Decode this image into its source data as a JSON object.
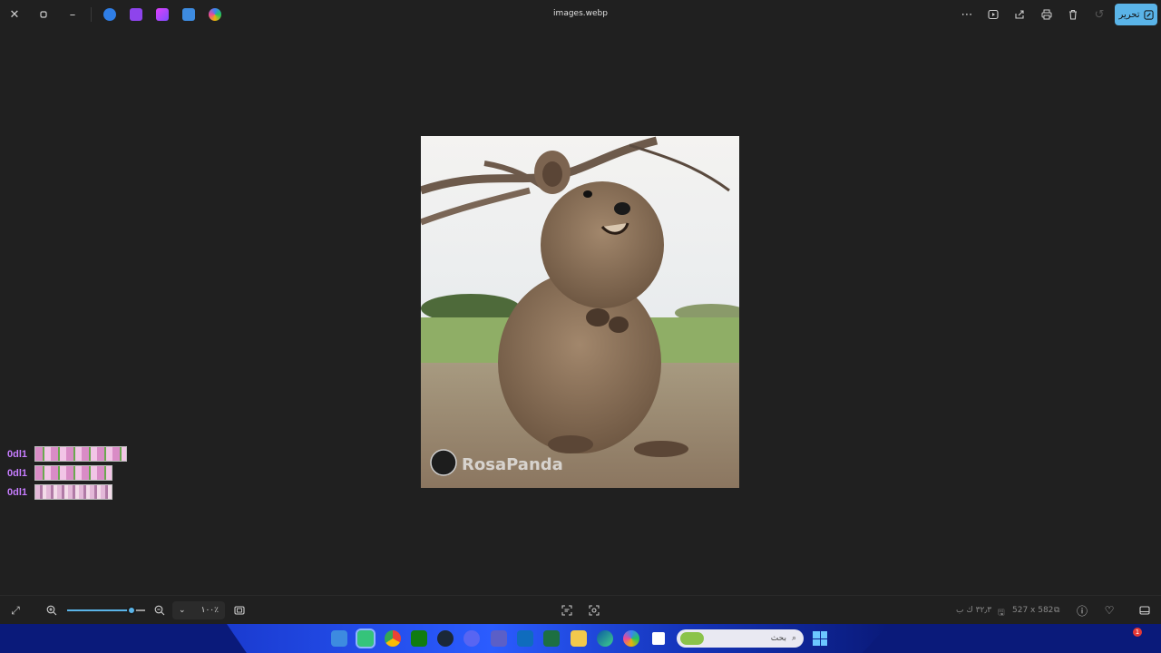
{
  "window": {
    "title": "images.webp",
    "edit_label": "تحرير"
  },
  "image": {
    "watermark": "RosaPanda"
  },
  "side_list": {
    "items": [
      {
        "label": "0dl1"
      },
      {
        "label": "0dl1"
      },
      {
        "label": "0dl1"
      }
    ]
  },
  "bottombar": {
    "zoom_value": "١٠٠٪",
    "zoom_fraction": 0.83,
    "dimensions": "527 x 582",
    "file_size": "٣٢٫٣ ك ب"
  },
  "taskbar": {
    "search_placeholder": "بحث",
    "notification_count": "1"
  },
  "colors": {
    "accent": "#5ab4e8",
    "background": "#202020",
    "side_label": "#c77dff"
  }
}
